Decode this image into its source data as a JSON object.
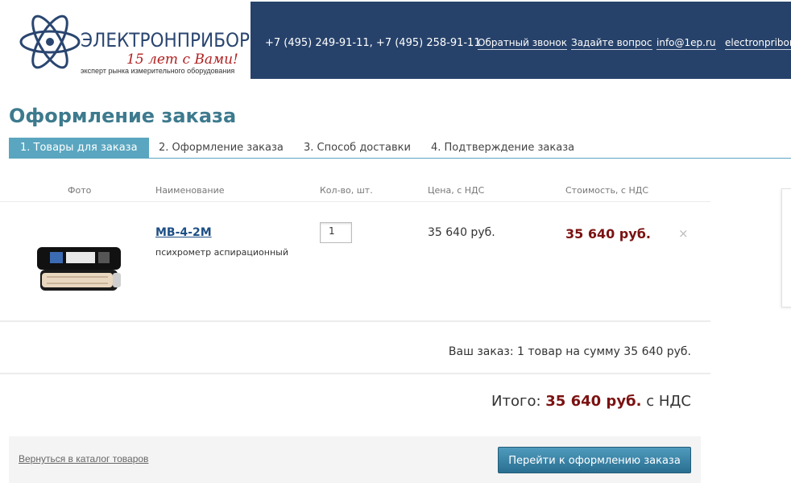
{
  "header": {
    "logo_name": "ЭЛЕКТРОНПРИБОР",
    "logo_years": "15 лет с Вами!",
    "logo_tagline": "эксперт рынка измерительного оборудования",
    "phones": "+7 (495) 249-91-11, +7 (495) 258-91-11",
    "links": [
      "Обратный звонок",
      "Задайте вопрос",
      "info@1ep.ru",
      "electronpribor"
    ],
    "colors": {
      "bar": "#27426a",
      "logo_blue": "#2a4670",
      "logo_red": "#b22020"
    }
  },
  "page_title": "Оформление заказа",
  "steps": [
    "1. Товары для заказа",
    "2. Оформление заказа",
    "3. Способ доставки",
    "4. Подтверждение заказа"
  ],
  "table": {
    "headers": [
      "Фото",
      "Наименование",
      "Кол-во, шт.",
      "Цена, с НДС",
      "Стоимость, с НДС"
    ],
    "rows": [
      {
        "name": "МВ-4-2М",
        "description": "психрометр аспирационный",
        "qty": "1",
        "price": "35 640 руб.",
        "cost": "35 640 руб.",
        "remove_icon": "×"
      }
    ]
  },
  "summary": "Ваш заказ: 1 товар на сумму 35 640 руб.",
  "total": {
    "label": "Итого:",
    "amount": "35 640 руб.",
    "suffix": "с НДС"
  },
  "footer": {
    "back_link": "Вернуться в каталог товаров",
    "checkout_button": "Перейти к оформлению заказа"
  },
  "colors": {
    "accent": "#5aa6c0",
    "price_red": "#7b1212",
    "link_blue": "#1e4f86"
  }
}
